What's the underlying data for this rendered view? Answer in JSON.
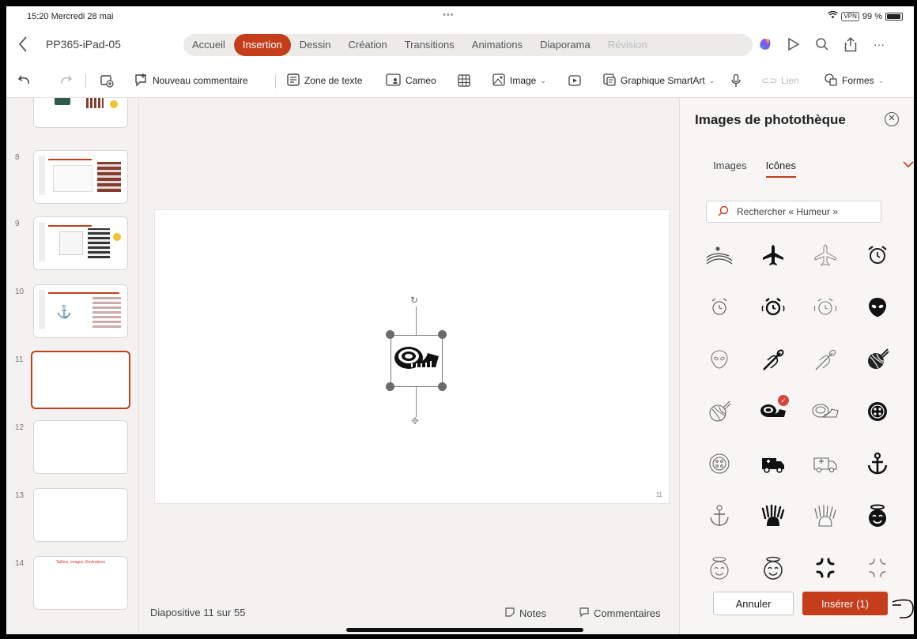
{
  "status": {
    "time": "15:20",
    "date": "Mercredi 28 mai",
    "vpn": "VPN",
    "battery": "99 %"
  },
  "document": {
    "title": "PP365-iPad-05"
  },
  "ribbon_tabs": [
    "Accueil",
    "Insertion",
    "Dessin",
    "Création",
    "Transitions",
    "Animations",
    "Diaporama",
    "Révision"
  ],
  "active_tab": "Insertion",
  "toolbar": {
    "new_comment": "Nouveau commentaire",
    "text_box": "Zone de texte",
    "cameo": "Cameo",
    "image": "Image",
    "smartart": "Graphique SmartArt",
    "link": "Lien",
    "shapes": "Formes"
  },
  "thumbnails": {
    "numbers": [
      "8",
      "9",
      "10",
      "11",
      "12",
      "13",
      "14"
    ],
    "slide14_text": "Taillers, images, illustrations",
    "selected": "11"
  },
  "editor": {
    "slide_number": "11",
    "slide_count": "Diapositive 11 sur 55",
    "notes": "Notes",
    "comments": "Commentaires"
  },
  "panel": {
    "title": "Images de photothèque",
    "tabs": [
      "Images",
      "Icônes"
    ],
    "active_tab": "Icônes",
    "search_placeholder": "Rechercher « Humeur »",
    "cancel": "Annuler",
    "insert": "Insérer (1)",
    "selected_badge": "✓",
    "icons": [
      "fields-icon",
      "airplane-filled-icon",
      "airplane-outline-icon",
      "alarm-clock-icon",
      "alarm-ringing-outline-icon",
      "alarm-ringing-filled-icon",
      "alarm-ringing-light-icon",
      "alien-filled-icon",
      "alien-outline-icon",
      "knitting-needle-filled-icon",
      "knitting-needle-outline-icon",
      "yarn-ball-filled-icon",
      "yarn-ball-outline-icon",
      "measuring-tape-filled-icon",
      "measuring-tape-outline-icon",
      "button-filled-icon",
      "button-outline-icon",
      "ambulance-filled-icon",
      "ambulance-outline-icon",
      "anchor-filled-icon",
      "anchor-outline-icon",
      "anemone-filled-icon",
      "anemone-outline-icon",
      "angel-face-filled-icon",
      "angel-face-outline-icon",
      "angel-face-light-icon",
      "anger-symbol-filled-icon",
      "anger-symbol-outline-icon"
    ]
  }
}
